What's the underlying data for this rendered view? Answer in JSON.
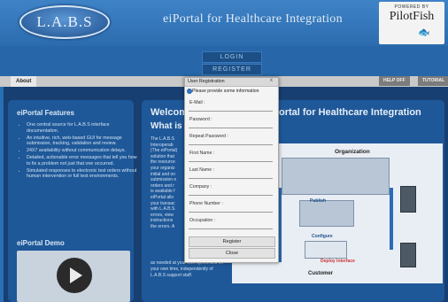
{
  "header": {
    "logo": "L.A.B.S",
    "title": "eiPortal for Healthcare Integration",
    "powered_by": "POWERED BY",
    "brand": "PilotFish"
  },
  "topbar": {
    "login": "LOGIN",
    "register": "REGISTER"
  },
  "tabs": {
    "about": "About",
    "right": [
      "HELP OFF",
      "TUTORIAL"
    ]
  },
  "left": {
    "features_title": "eiPortal Features",
    "features": [
      "One central source for L.A.B.S interface documentation.",
      "An intuitive, rich, web-based GUI for message submission, tracking, validation and review.",
      "24X7 availability without communication delays.",
      "Detailed, actionable error messages that tell you how to fix a problem not just that one occurred.",
      "Simulated responses to electronic test orders without human intervention or full test environments."
    ],
    "demo_title": "eiPortal Demo"
  },
  "main": {
    "title_left": "Welcome",
    "title_right": "ortal for Healthcare Integration",
    "what": "What is",
    "body_lines": [
      "The L.A.B.S",
      "Interoperab",
      "(The eiPortal)",
      "solution that",
      "the resource",
      "your organiz",
      "initial and on",
      "submission e",
      "orders and r",
      "is available f",
      "eiPortal allo",
      "your transac",
      "with L.A.B.S.",
      "errors, view",
      "instructions",
      "the errors. A"
    ],
    "body_bottom": "as needed at your own speed and on your own time, independently of L.A.B.S support staff."
  },
  "diagram": {
    "organization": "Organization",
    "customer": "Customer",
    "deploy": "Deploy Interface",
    "publish": "Publish",
    "configure": "Configure"
  },
  "modal": {
    "title": "User Registration",
    "close_x": "x",
    "notice": "Please provide some information",
    "fields": [
      {
        "label": "E-Mail :",
        "value": ""
      },
      {
        "label": "Password :",
        "value": ""
      },
      {
        "label": "Repeat Password :",
        "value": ""
      },
      {
        "label": "First Name :",
        "value": ""
      },
      {
        "label": "Last Name :",
        "value": ""
      },
      {
        "label": "Company :",
        "value": ""
      },
      {
        "label": "Phone Number :",
        "value": ""
      },
      {
        "label": "Occupation :",
        "value": ""
      }
    ],
    "register": "Register",
    "close": "Close"
  }
}
